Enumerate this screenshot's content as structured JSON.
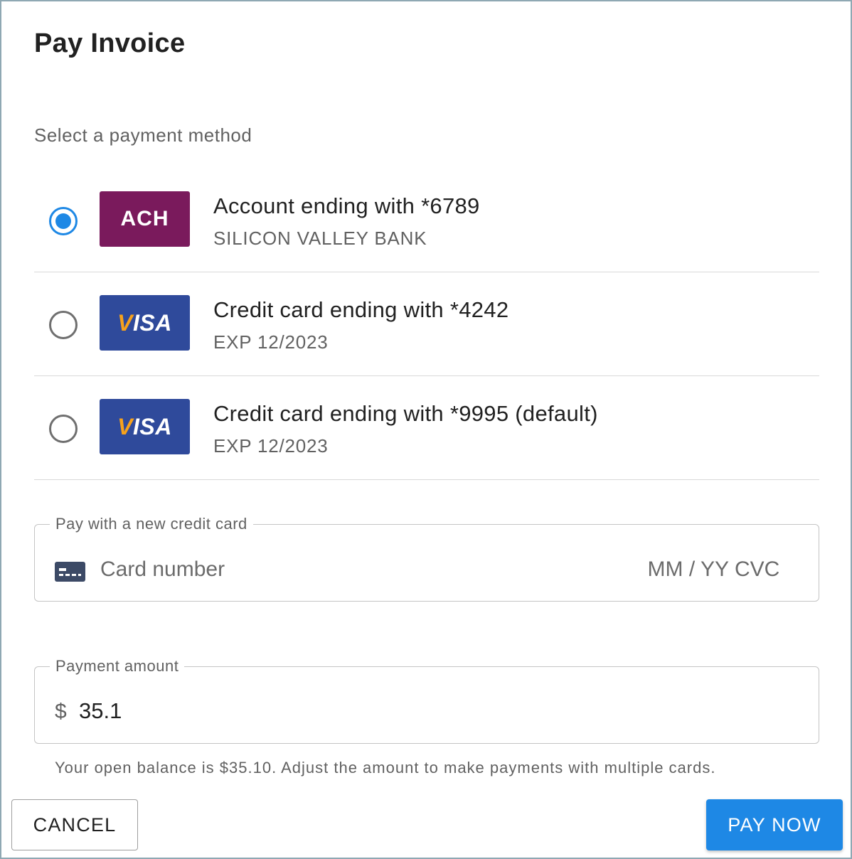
{
  "dialog": {
    "title": "Pay Invoice",
    "subtitle": "Select a payment method"
  },
  "methods": [
    {
      "logo": "ACH",
      "title": "Account ending with *6789",
      "subtitle": "SILICON VALLEY BANK",
      "selected": true
    },
    {
      "logo": "VISA",
      "title": "Credit card ending with *4242",
      "subtitle": "EXP 12/2023",
      "selected": false
    },
    {
      "logo": "VISA",
      "title": "Credit card ending with *9995 (default)",
      "subtitle": "EXP 12/2023",
      "selected": false
    }
  ],
  "new_card": {
    "legend": "Pay with a new credit card",
    "card_placeholder": "Card number",
    "exp_placeholder": "MM / YY",
    "cvc_placeholder": "CVC"
  },
  "amount": {
    "legend": "Payment amount",
    "currency": "$",
    "value": "35.1",
    "helper": "Your open balance is $35.10. Adjust the amount to make payments with multiple cards."
  },
  "actions": {
    "cancel_label": "CANCEL",
    "pay_label": "PAY NOW"
  },
  "colors": {
    "primary": "#1e88e5",
    "ach_brand": "#7a1a5c",
    "visa_brand": "#2f4a9b",
    "visa_accent": "#f7a21b"
  }
}
